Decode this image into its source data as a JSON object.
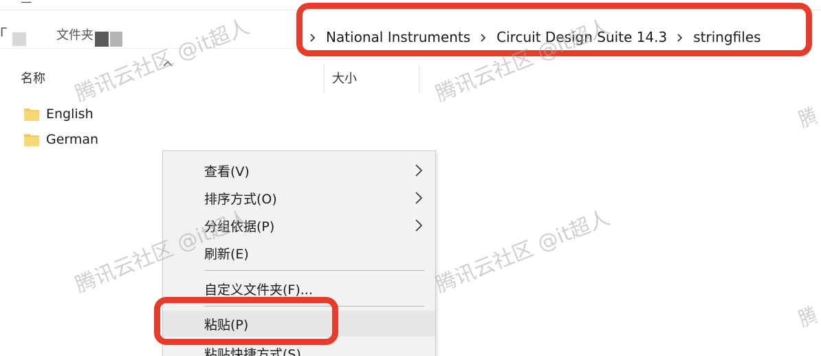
{
  "top": {
    "fragment": "ᅳ"
  },
  "address": {
    "fragment": "Г",
    "fragment2": "文件夹",
    "breadcrumb": [
      "National Instruments",
      "Circuit Design Suite 14.3",
      "stringfiles"
    ]
  },
  "columns": {
    "name": "名称",
    "size": "大小"
  },
  "files": [
    {
      "name": "English",
      "icon": "folder-icon"
    },
    {
      "name": "German",
      "icon": "folder-icon"
    }
  ],
  "context_menu": {
    "view": "查看(V)",
    "sort": "排序方式(O)",
    "group": "分组依据(P)",
    "refresh": "刷新(E)",
    "customize": "自定义文件夹(F)...",
    "paste": "粘贴(P)",
    "paste_shortcut": "粘贴快捷方式(S)"
  },
  "watermark": {
    "text": "腾讯云社区 @it超人",
    "edge_fragment": "腾"
  },
  "colors": {
    "highlight": "#e43d2b",
    "folder": "#f4c956",
    "menu_bg": "#f2f2f2"
  }
}
